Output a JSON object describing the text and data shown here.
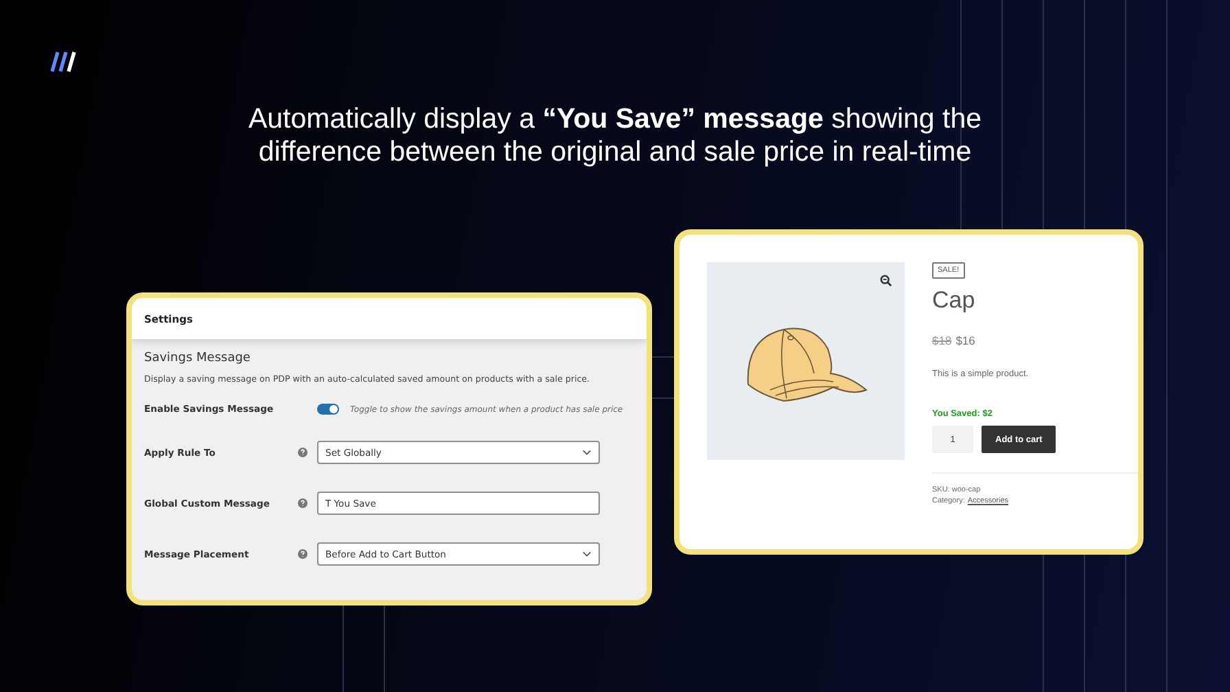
{
  "headline_lines": [
    "Automatically display a **“You Save” message** showing the",
    "difference between the original and sale price in real-time"
  ],
  "settings": {
    "title": "Settings",
    "section_title": "Savings Message",
    "description": "Display a saving message on PDP with an auto-calculated saved amount on products with a sale price.",
    "fields": [
      {
        "kind": "toggle",
        "label": "Enable Savings Message",
        "on": true,
        "hint": "Toggle to show the savings amount when a product has sale price"
      },
      {
        "kind": "select",
        "label": "Apply Rule To",
        "value": "Set Globally"
      },
      {
        "kind": "text",
        "label": "Global Custom Message",
        "value": "T You Save"
      },
      {
        "kind": "select",
        "label": "Message Placement",
        "value": "Before Add to Cart Button"
      }
    ]
  },
  "product": {
    "badge": "SALE!",
    "title": "Cap",
    "old_price": "$18",
    "price": "$16",
    "description": "This is a simple product.",
    "saved_message": "You Saved: $2",
    "quantity": "1",
    "add_button": "Add to cart",
    "sku": "SKU: woo-cap",
    "category_label": "Category:",
    "category": "Accessories"
  }
}
